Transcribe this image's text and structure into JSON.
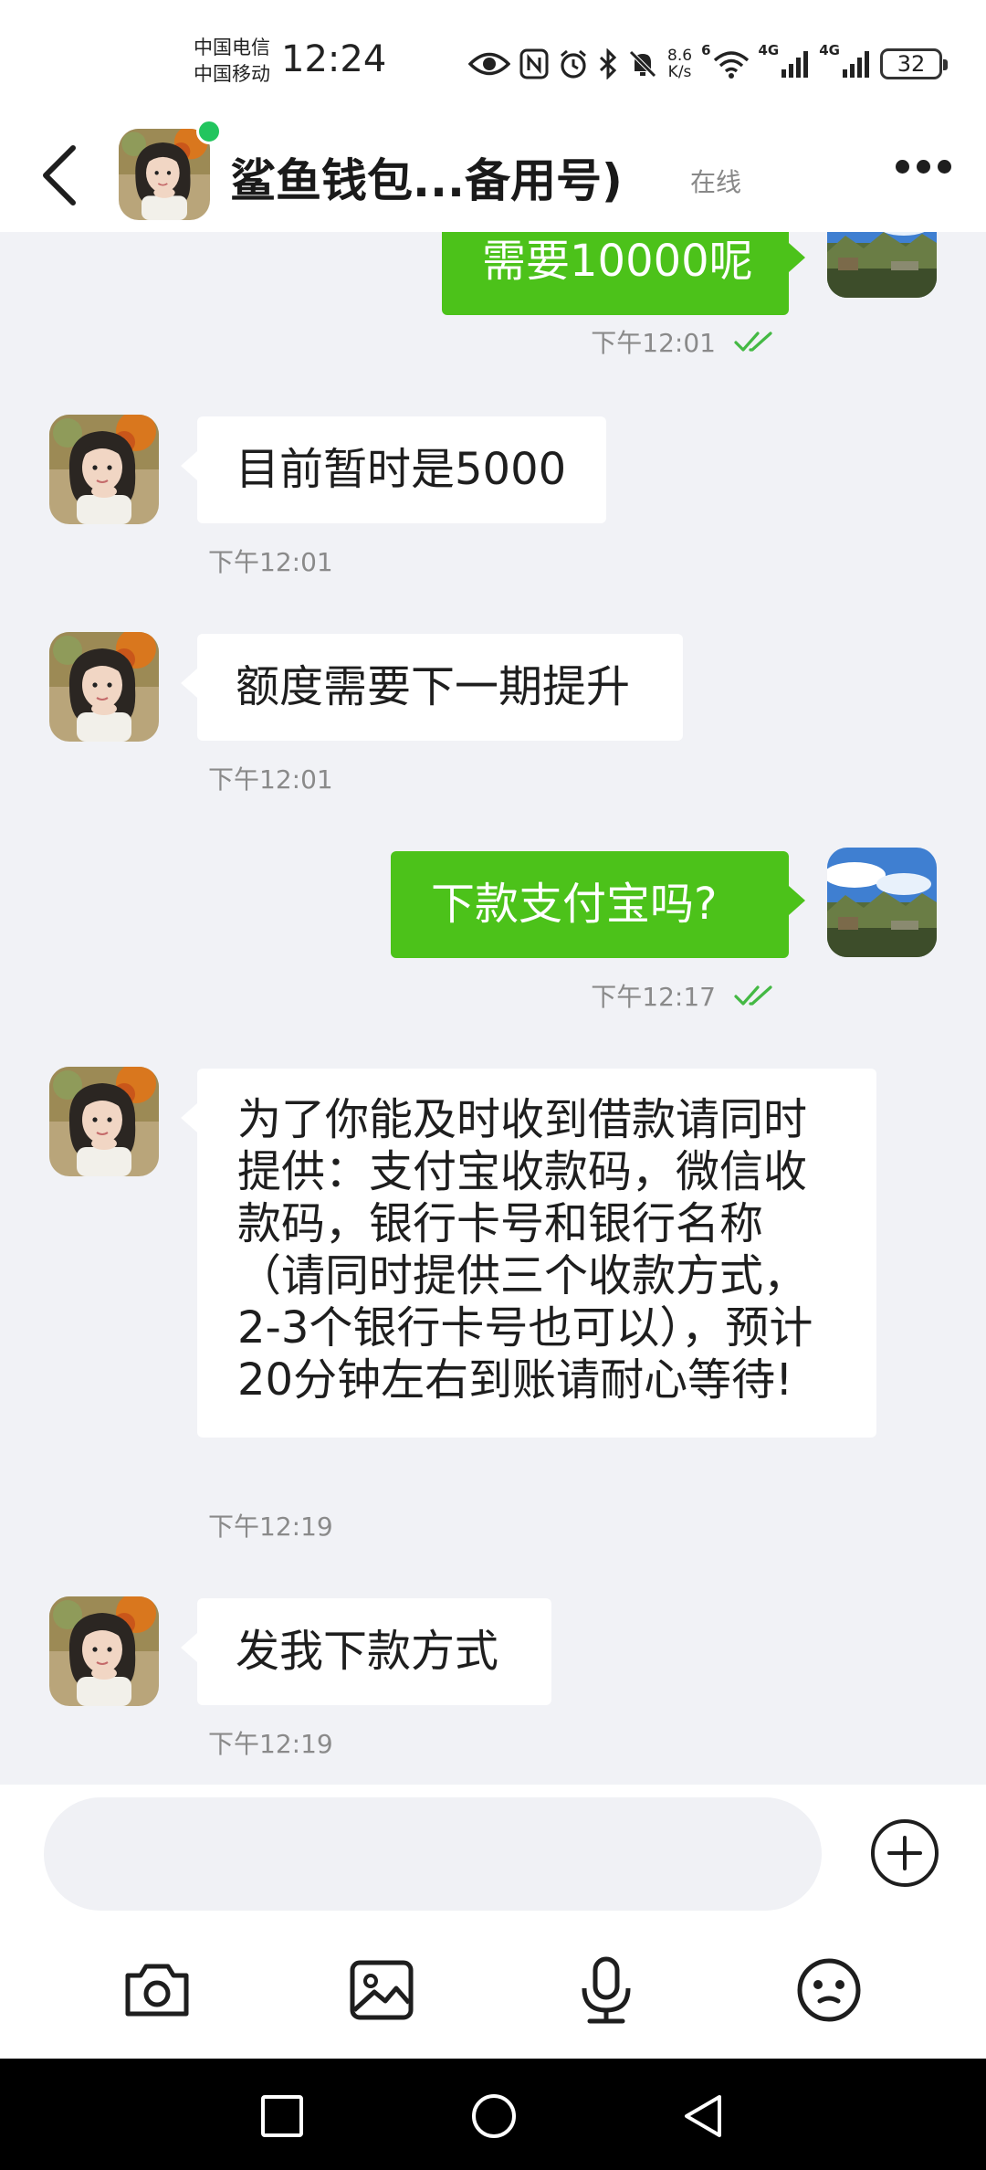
{
  "status_bar": {
    "carrier_1": "中国电信",
    "carrier_2": "中国移动",
    "time": "12:24",
    "net_speed_value": "8.6",
    "net_speed_unit": "K/s",
    "signal_1_label": "4G",
    "signal_2_label": "4G",
    "wifi_label": "6",
    "battery": "32"
  },
  "header": {
    "contact_name": "鲨鱼钱包...备用号)",
    "online_status": "在线"
  },
  "messages": [
    {
      "text": "需要10000呢",
      "time": "下午12:01"
    },
    {
      "text": "目前暂时是5000",
      "time": "下午12:01"
    },
    {
      "text": "额度需要下一期提升",
      "time": "下午12:01"
    },
    {
      "text": "下款支付宝吗?",
      "time": "下午12:17"
    },
    {
      "text": "为了你能及时收到借款请同时提供：支付宝收款码，微信收款码，银行卡号和银行名称（请同时提供三个收款方式，2-3个银行卡号也可以），预计20分钟左右到账请耐心等待!",
      "time": "下午12:19"
    },
    {
      "text": "发我下款方式",
      "time": "下午12:19"
    }
  ],
  "input": {
    "placeholder": ""
  },
  "colors": {
    "outgoing_bubble": "#4cc21a",
    "incoming_bubble": "#ffffff",
    "online_dot": "#22c55e",
    "chat_background": "#f1f2f6"
  },
  "icons": {
    "back": "chevron-left-icon",
    "more": "more-dots-icon",
    "read": "double-check-icon",
    "add": "plus-circle-icon",
    "camera": "camera-icon",
    "gallery": "image-icon",
    "voice": "microphone-icon",
    "emoji": "emoji-icon"
  }
}
